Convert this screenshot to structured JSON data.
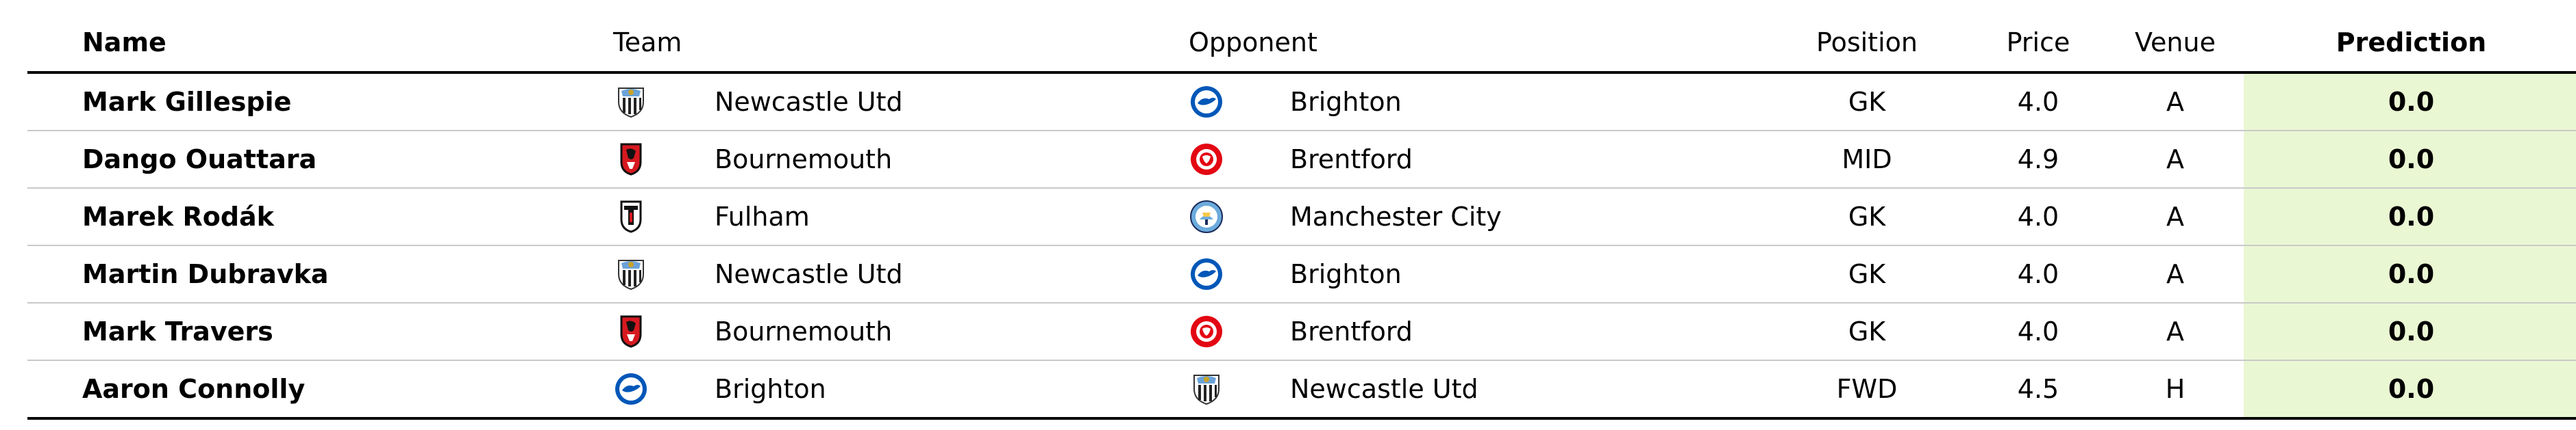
{
  "columns": {
    "name": "Name",
    "team": "Team",
    "opponent": "Opponent",
    "position": "Position",
    "price": "Price",
    "venue": "Venue",
    "prediction": "Prediction"
  },
  "colors": {
    "prediction_bg": "#eaf7d3",
    "header_rule": "#000000",
    "row_rule": "#c9c9c9"
  },
  "rows": [
    {
      "name": "Mark Gillespie",
      "team": "Newcastle Utd",
      "team_badge": "newcastle-badge-icon",
      "opponent": "Brighton",
      "opponent_badge": "brighton-badge-icon",
      "position": "GK",
      "price": "4.0",
      "venue": "A",
      "prediction": "0.0"
    },
    {
      "name": "Dango Ouattara",
      "team": "Bournemouth",
      "team_badge": "bournemouth-badge-icon",
      "opponent": "Brentford",
      "opponent_badge": "brentford-badge-icon",
      "position": "MID",
      "price": "4.9",
      "venue": "A",
      "prediction": "0.0"
    },
    {
      "name": "Marek Rodák",
      "team": "Fulham",
      "team_badge": "fulham-badge-icon",
      "opponent": "Manchester City",
      "opponent_badge": "manchester-city-badge-icon",
      "position": "GK",
      "price": "4.0",
      "venue": "A",
      "prediction": "0.0"
    },
    {
      "name": "Martin Dubravka",
      "team": "Newcastle Utd",
      "team_badge": "newcastle-badge-icon",
      "opponent": "Brighton",
      "opponent_badge": "brighton-badge-icon",
      "position": "GK",
      "price": "4.0",
      "venue": "A",
      "prediction": "0.0"
    },
    {
      "name": "Mark Travers",
      "team": "Bournemouth",
      "team_badge": "bournemouth-badge-icon",
      "opponent": "Brentford",
      "opponent_badge": "brentford-badge-icon",
      "position": "GK",
      "price": "4.0",
      "venue": "A",
      "prediction": "0.0"
    },
    {
      "name": "Aaron Connolly",
      "team": "Brighton",
      "team_badge": "brighton-badge-icon",
      "opponent": "Newcastle Utd",
      "opponent_badge": "newcastle-badge-icon",
      "position": "FWD",
      "price": "4.5",
      "venue": "H",
      "prediction": "0.0"
    }
  ]
}
